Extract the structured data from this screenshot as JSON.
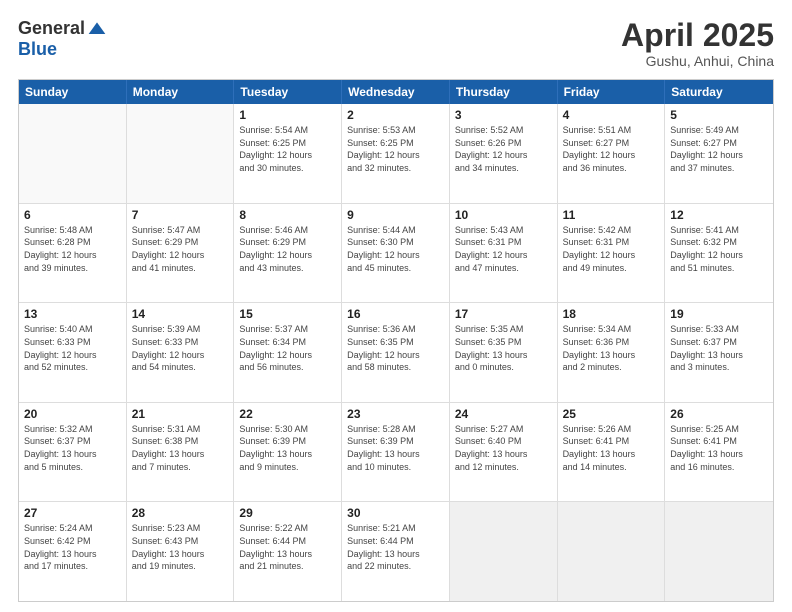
{
  "header": {
    "logo_general": "General",
    "logo_blue": "Blue",
    "title": "April 2025",
    "location": "Gushu, Anhui, China"
  },
  "calendar": {
    "days": [
      "Sunday",
      "Monday",
      "Tuesday",
      "Wednesday",
      "Thursday",
      "Friday",
      "Saturday"
    ],
    "rows": [
      [
        {
          "day": "",
          "info": ""
        },
        {
          "day": "",
          "info": ""
        },
        {
          "day": "1",
          "info": "Sunrise: 5:54 AM\nSunset: 6:25 PM\nDaylight: 12 hours\nand 30 minutes."
        },
        {
          "day": "2",
          "info": "Sunrise: 5:53 AM\nSunset: 6:25 PM\nDaylight: 12 hours\nand 32 minutes."
        },
        {
          "day": "3",
          "info": "Sunrise: 5:52 AM\nSunset: 6:26 PM\nDaylight: 12 hours\nand 34 minutes."
        },
        {
          "day": "4",
          "info": "Sunrise: 5:51 AM\nSunset: 6:27 PM\nDaylight: 12 hours\nand 36 minutes."
        },
        {
          "day": "5",
          "info": "Sunrise: 5:49 AM\nSunset: 6:27 PM\nDaylight: 12 hours\nand 37 minutes."
        }
      ],
      [
        {
          "day": "6",
          "info": "Sunrise: 5:48 AM\nSunset: 6:28 PM\nDaylight: 12 hours\nand 39 minutes."
        },
        {
          "day": "7",
          "info": "Sunrise: 5:47 AM\nSunset: 6:29 PM\nDaylight: 12 hours\nand 41 minutes."
        },
        {
          "day": "8",
          "info": "Sunrise: 5:46 AM\nSunset: 6:29 PM\nDaylight: 12 hours\nand 43 minutes."
        },
        {
          "day": "9",
          "info": "Sunrise: 5:44 AM\nSunset: 6:30 PM\nDaylight: 12 hours\nand 45 minutes."
        },
        {
          "day": "10",
          "info": "Sunrise: 5:43 AM\nSunset: 6:31 PM\nDaylight: 12 hours\nand 47 minutes."
        },
        {
          "day": "11",
          "info": "Sunrise: 5:42 AM\nSunset: 6:31 PM\nDaylight: 12 hours\nand 49 minutes."
        },
        {
          "day": "12",
          "info": "Sunrise: 5:41 AM\nSunset: 6:32 PM\nDaylight: 12 hours\nand 51 minutes."
        }
      ],
      [
        {
          "day": "13",
          "info": "Sunrise: 5:40 AM\nSunset: 6:33 PM\nDaylight: 12 hours\nand 52 minutes."
        },
        {
          "day": "14",
          "info": "Sunrise: 5:39 AM\nSunset: 6:33 PM\nDaylight: 12 hours\nand 54 minutes."
        },
        {
          "day": "15",
          "info": "Sunrise: 5:37 AM\nSunset: 6:34 PM\nDaylight: 12 hours\nand 56 minutes."
        },
        {
          "day": "16",
          "info": "Sunrise: 5:36 AM\nSunset: 6:35 PM\nDaylight: 12 hours\nand 58 minutes."
        },
        {
          "day": "17",
          "info": "Sunrise: 5:35 AM\nSunset: 6:35 PM\nDaylight: 13 hours\nand 0 minutes."
        },
        {
          "day": "18",
          "info": "Sunrise: 5:34 AM\nSunset: 6:36 PM\nDaylight: 13 hours\nand 2 minutes."
        },
        {
          "day": "19",
          "info": "Sunrise: 5:33 AM\nSunset: 6:37 PM\nDaylight: 13 hours\nand 3 minutes."
        }
      ],
      [
        {
          "day": "20",
          "info": "Sunrise: 5:32 AM\nSunset: 6:37 PM\nDaylight: 13 hours\nand 5 minutes."
        },
        {
          "day": "21",
          "info": "Sunrise: 5:31 AM\nSunset: 6:38 PM\nDaylight: 13 hours\nand 7 minutes."
        },
        {
          "day": "22",
          "info": "Sunrise: 5:30 AM\nSunset: 6:39 PM\nDaylight: 13 hours\nand 9 minutes."
        },
        {
          "day": "23",
          "info": "Sunrise: 5:28 AM\nSunset: 6:39 PM\nDaylight: 13 hours\nand 10 minutes."
        },
        {
          "day": "24",
          "info": "Sunrise: 5:27 AM\nSunset: 6:40 PM\nDaylight: 13 hours\nand 12 minutes."
        },
        {
          "day": "25",
          "info": "Sunrise: 5:26 AM\nSunset: 6:41 PM\nDaylight: 13 hours\nand 14 minutes."
        },
        {
          "day": "26",
          "info": "Sunrise: 5:25 AM\nSunset: 6:41 PM\nDaylight: 13 hours\nand 16 minutes."
        }
      ],
      [
        {
          "day": "27",
          "info": "Sunrise: 5:24 AM\nSunset: 6:42 PM\nDaylight: 13 hours\nand 17 minutes."
        },
        {
          "day": "28",
          "info": "Sunrise: 5:23 AM\nSunset: 6:43 PM\nDaylight: 13 hours\nand 19 minutes."
        },
        {
          "day": "29",
          "info": "Sunrise: 5:22 AM\nSunset: 6:44 PM\nDaylight: 13 hours\nand 21 minutes."
        },
        {
          "day": "30",
          "info": "Sunrise: 5:21 AM\nSunset: 6:44 PM\nDaylight: 13 hours\nand 22 minutes."
        },
        {
          "day": "",
          "info": ""
        },
        {
          "day": "",
          "info": ""
        },
        {
          "day": "",
          "info": ""
        }
      ]
    ]
  }
}
